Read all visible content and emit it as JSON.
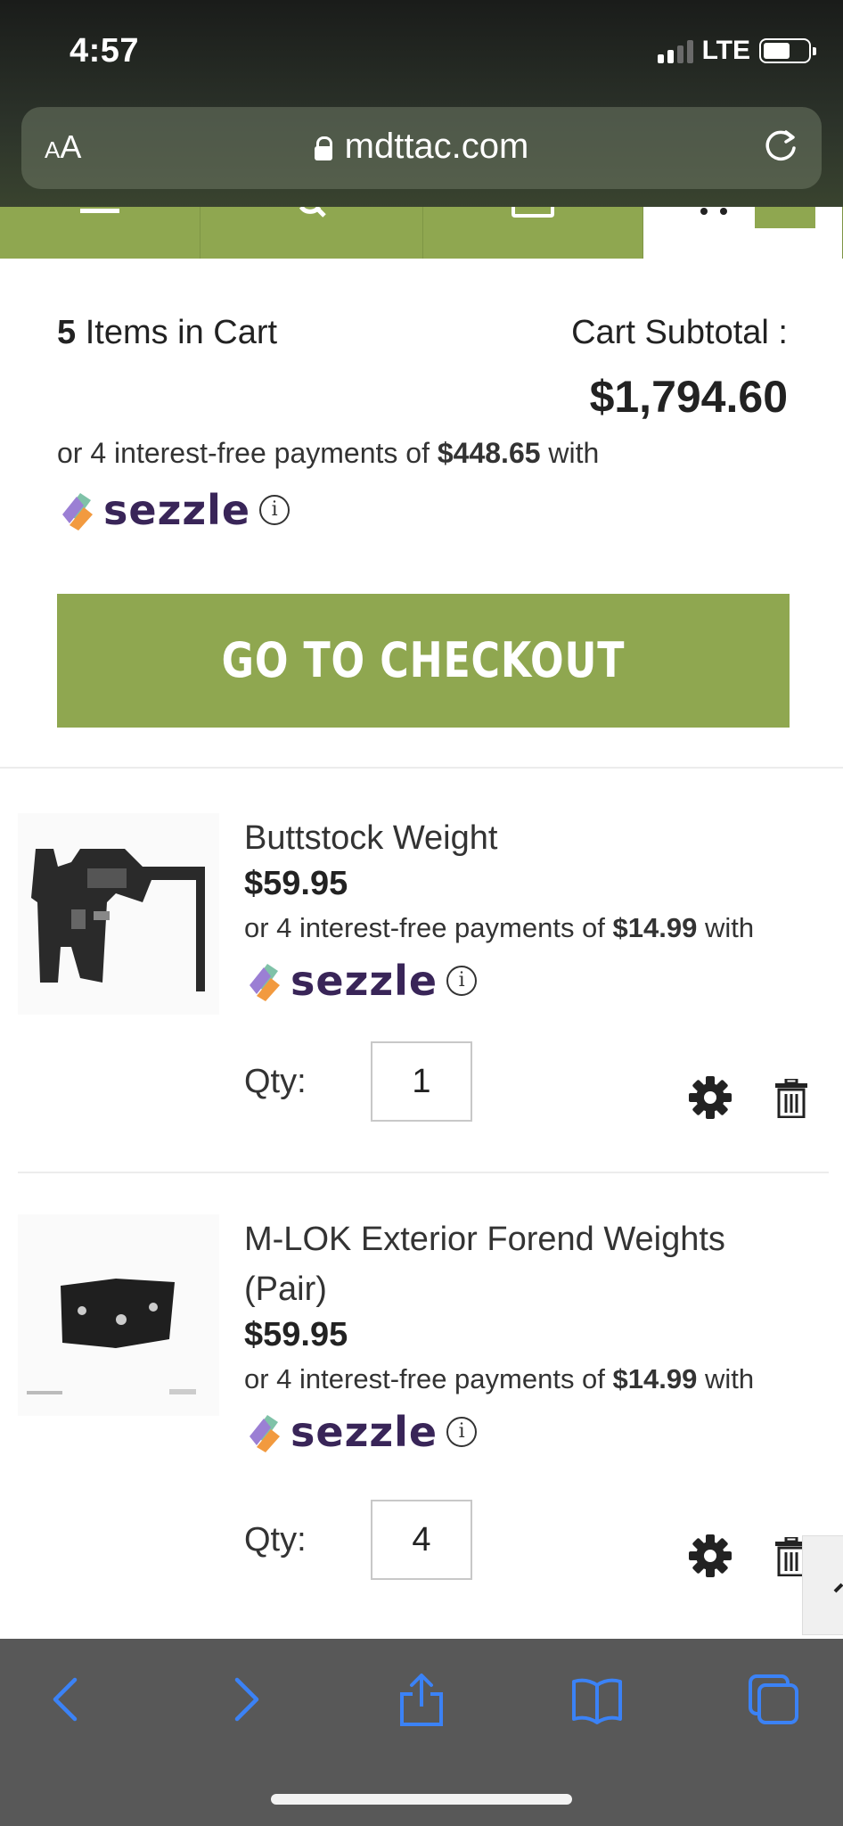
{
  "status_bar": {
    "time": "4:57",
    "network": "LTE"
  },
  "browser": {
    "text_size_label": "AA",
    "url": "mdttac.com"
  },
  "cart": {
    "item_count": "5",
    "items_label": "Items in Cart",
    "subtotal_label": "Cart Subtotal :",
    "subtotal_value": "$1,794.60",
    "installment_prefix": "or 4 interest-free payments of",
    "installment_amount": "$448.65",
    "installment_suffix": "with",
    "sezzle_brand": "sezzle",
    "info_glyph": "i",
    "checkout_label": "GO TO CHECKOUT"
  },
  "items": [
    {
      "name_line1": "Buttstock Weight",
      "name_line2": "",
      "price": "$59.95",
      "installment_prefix": "or 4 interest-free payments of",
      "installment_amount": "$14.99",
      "installment_suffix": "with",
      "sezzle_brand": "sezzle",
      "qty_label": "Qty:",
      "qty": "1"
    },
    {
      "name_line1": "M-LOK Exterior Forend Weights",
      "name_line2": "(Pair)",
      "price": "$59.95",
      "installment_prefix": "or 4 interest-free payments of",
      "installment_amount": "$14.99",
      "installment_suffix": "with",
      "sezzle_brand": "sezzle",
      "qty_label": "Qty:",
      "qty": "4"
    }
  ],
  "colors": {
    "brand_green": "#8fa750",
    "sezzle_purple": "#392558",
    "toolbar_blue": "#3b82f6"
  },
  "icons": [
    "lock-icon",
    "reload-icon",
    "menu-icon",
    "search-icon",
    "account-icon",
    "cart-icon",
    "info-icon",
    "gear-icon",
    "trash-icon",
    "back-icon",
    "forward-icon",
    "share-icon",
    "bookmarks-icon",
    "tabs-icon"
  ]
}
